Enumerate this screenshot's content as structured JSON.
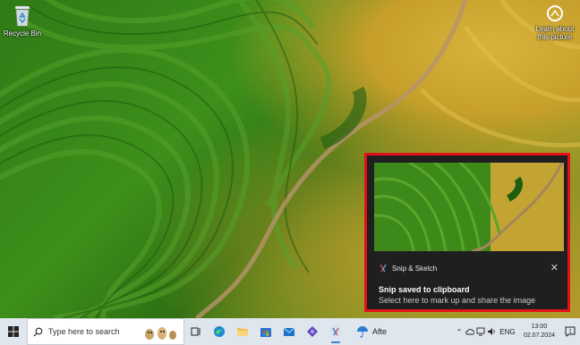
{
  "desktop": {
    "recycle_bin_label": "Recycle Bin",
    "learn_label": "Learn about this picture"
  },
  "notification": {
    "app_name": "Snip & Sketch",
    "title": "Snip saved to clipboard",
    "body": "Select here to mark up and share the image",
    "close_glyph": "✕",
    "highlight_color": "#e3101a"
  },
  "taskbar": {
    "search_placeholder": "Type here to search",
    "weather_label": "Afte",
    "language": "ENG",
    "time": "13:00",
    "date": "02.07.2024",
    "notification_count": "1",
    "apps": [
      "task-view-icon",
      "edge-icon",
      "file-explorer-icon",
      "store-icon",
      "mail-icon",
      "photos-icon",
      "snip-sketch-icon"
    ]
  }
}
